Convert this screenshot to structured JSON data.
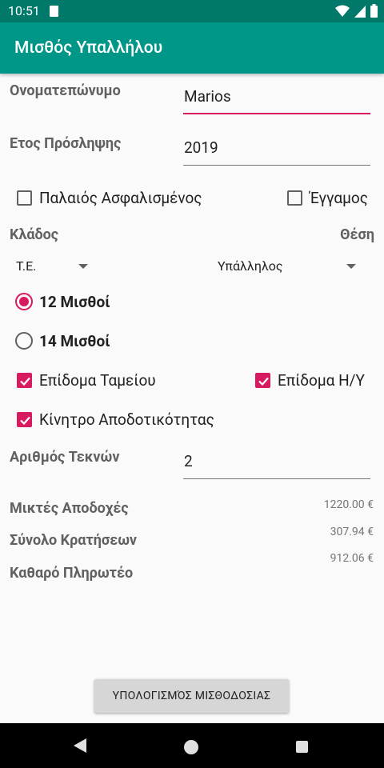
{
  "status_bar": {
    "time": "10:51"
  },
  "app_bar": {
    "title": "Μισθός Υπαλλήλου"
  },
  "form": {
    "name_label": "Ονοματεπώνυμο",
    "name_value": "Marios",
    "year_label": "Ετος Πρόσληψης",
    "year_value": "2019",
    "old_insured_label": "Παλαιός Ασφαλισμένος",
    "old_insured_checked": false,
    "married_label": "Έγγαμος",
    "married_checked": false,
    "branch_label": "Κλάδος",
    "position_label": "Θέση",
    "branch_value": "Τ.Ε.",
    "position_value": "Υπάλληλος",
    "salaries_12_label": "12 Μισθοί",
    "salaries_14_label": "14 Μισθοί",
    "selected_salaries": "12",
    "fund_allowance_label": "Επίδομα Ταμείου",
    "fund_allowance_checked": true,
    "pc_allowance_label": "Επίδομα Η/Υ",
    "pc_allowance_checked": true,
    "productivity_label": "Κίνητρο Αποδοτικότητας",
    "productivity_checked": true,
    "children_label": "Αριθμός Τεκνών",
    "children_value": "2"
  },
  "summary": {
    "gross_label": "Μικτές Αποδοχές",
    "gross_value": "1220.00 €",
    "deductions_label": "Σύνολο Κρατήσεων",
    "deductions_value": "307.94 €",
    "net_label": "Καθαρό Πληρωτέο",
    "net_value": "912.06 €"
  },
  "actions": {
    "calculate_label": "ΥΠΟΛΟΓΙΣΜΌΣ ΜΙΣΘΟΔΟΣΙΑΣ"
  },
  "colors": {
    "primary": "#009688",
    "primary_dark": "#00796b",
    "accent": "#d81b60"
  },
  "icons": {
    "status": [
      "sd-card-icon",
      "wifi-icon",
      "signal-icon",
      "battery-icon"
    ],
    "nav": [
      "back-icon",
      "home-icon",
      "recents-icon"
    ]
  }
}
